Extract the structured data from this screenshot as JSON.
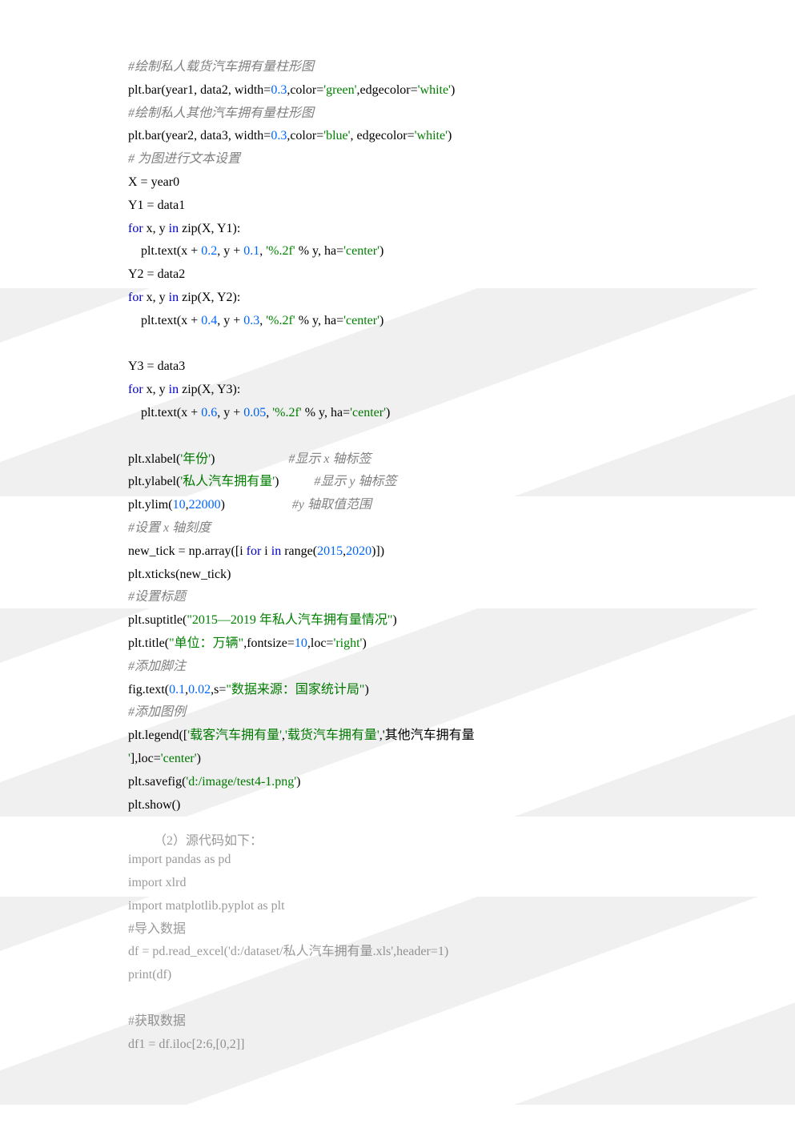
{
  "block1": {
    "lines": [
      {
        "segs": [
          {
            "t": "#绘制私人载货汽车拥有量柱形图",
            "cls": "c-cmt"
          }
        ]
      },
      {
        "segs": [
          {
            "t": "plt.bar(year1, data2, "
          },
          {
            "t": "width",
            "cls": "c-id"
          },
          {
            "t": "="
          },
          {
            "t": "0.3",
            "cls": "c-num"
          },
          {
            "t": ","
          },
          {
            "t": "color",
            "cls": "c-id"
          },
          {
            "t": "="
          },
          {
            "t": "'green'",
            "cls": "c-str"
          },
          {
            "t": ","
          },
          {
            "t": "edgecolor",
            "cls": "c-id"
          },
          {
            "t": "="
          },
          {
            "t": "'white'",
            "cls": "c-str"
          },
          {
            "t": ")"
          }
        ]
      },
      {
        "segs": [
          {
            "t": "#绘制私人其他汽车拥有量柱形图",
            "cls": "c-cmt"
          }
        ]
      },
      {
        "segs": [
          {
            "t": "plt.bar(year2, data3, "
          },
          {
            "t": "width",
            "cls": "c-id"
          },
          {
            "t": "="
          },
          {
            "t": "0.3",
            "cls": "c-num"
          },
          {
            "t": ","
          },
          {
            "t": "color",
            "cls": "c-id"
          },
          {
            "t": "="
          },
          {
            "t": "'blue'",
            "cls": "c-str"
          },
          {
            "t": ", "
          },
          {
            "t": "edgecolor",
            "cls": "c-id"
          },
          {
            "t": "="
          },
          {
            "t": "'white'",
            "cls": "c-str"
          },
          {
            "t": ")"
          }
        ]
      },
      {
        "segs": [
          {
            "t": "# 为图进行文本设置",
            "cls": "c-cmt"
          }
        ]
      },
      {
        "segs": [
          {
            "t": "X = year0"
          }
        ]
      },
      {
        "segs": [
          {
            "t": "Y1 = data1"
          }
        ]
      },
      {
        "segs": [
          {
            "t": "for ",
            "cls": "c-kw"
          },
          {
            "t": "x, y "
          },
          {
            "t": "in ",
            "cls": "c-kw"
          },
          {
            "t": "zip(X, Y1):"
          }
        ]
      },
      {
        "segs": [
          {
            "t": "    plt.text(x + "
          },
          {
            "t": "0.2",
            "cls": "c-num"
          },
          {
            "t": ", y + "
          },
          {
            "t": "0.1",
            "cls": "c-num"
          },
          {
            "t": ", "
          },
          {
            "t": "'%.2f'",
            "cls": "c-str"
          },
          {
            "t": " % y, "
          },
          {
            "t": "ha",
            "cls": "c-id"
          },
          {
            "t": "="
          },
          {
            "t": "'center'",
            "cls": "c-str"
          },
          {
            "t": ")"
          }
        ]
      },
      {
        "segs": [
          {
            "t": "Y2 = data2"
          }
        ]
      },
      {
        "segs": [
          {
            "t": "for ",
            "cls": "c-kw"
          },
          {
            "t": "x, y "
          },
          {
            "t": "in ",
            "cls": "c-kw"
          },
          {
            "t": "zip(X, Y2):"
          }
        ]
      },
      {
        "segs": [
          {
            "t": "    plt.text(x + "
          },
          {
            "t": "0.4",
            "cls": "c-num"
          },
          {
            "t": ", y + "
          },
          {
            "t": "0.3",
            "cls": "c-num"
          },
          {
            "t": ", "
          },
          {
            "t": "'%.2f'",
            "cls": "c-str"
          },
          {
            "t": " % y, "
          },
          {
            "t": "ha",
            "cls": "c-id"
          },
          {
            "t": "="
          },
          {
            "t": "'center'",
            "cls": "c-str"
          },
          {
            "t": ")"
          }
        ]
      },
      {
        "segs": [
          {
            "t": ""
          }
        ]
      },
      {
        "segs": [
          {
            "t": "Y3 = data3"
          }
        ]
      },
      {
        "segs": [
          {
            "t": "for ",
            "cls": "c-kw"
          },
          {
            "t": "x, y "
          },
          {
            "t": "in ",
            "cls": "c-kw"
          },
          {
            "t": "zip(X, Y3):"
          }
        ]
      },
      {
        "segs": [
          {
            "t": "    plt.text(x + "
          },
          {
            "t": "0.6",
            "cls": "c-num"
          },
          {
            "t": ", y + "
          },
          {
            "t": "0.05",
            "cls": "c-num"
          },
          {
            "t": ", "
          },
          {
            "t": "'%.2f'",
            "cls": "c-str"
          },
          {
            "t": " % y, "
          },
          {
            "t": "ha",
            "cls": "c-id"
          },
          {
            "t": "="
          },
          {
            "t": "'center'",
            "cls": "c-str"
          },
          {
            "t": ")"
          }
        ]
      },
      {
        "segs": [
          {
            "t": ""
          }
        ]
      },
      {
        "segs": [
          {
            "t": "plt.xlabel("
          },
          {
            "t": "'年份'",
            "cls": "c-str"
          },
          {
            "t": ")                       "
          },
          {
            "t": "#显示 x 轴标签",
            "cls": "c-cmt"
          }
        ]
      },
      {
        "segs": [
          {
            "t": "plt.ylabel("
          },
          {
            "t": "'私人汽车拥有量'",
            "cls": "c-str"
          },
          {
            "t": ")           "
          },
          {
            "t": "#显示 y 轴标签",
            "cls": "c-cmt"
          }
        ]
      },
      {
        "segs": [
          {
            "t": "plt.ylim("
          },
          {
            "t": "10",
            "cls": "c-num"
          },
          {
            "t": ","
          },
          {
            "t": "22000",
            "cls": "c-num"
          },
          {
            "t": ")                     "
          },
          {
            "t": "#y 轴取值范围",
            "cls": "c-cmt"
          }
        ]
      },
      {
        "segs": [
          {
            "t": "#设置 x 轴刻度",
            "cls": "c-cmt"
          }
        ]
      },
      {
        "segs": [
          {
            "t": "new_tick = np.array([i "
          },
          {
            "t": "for ",
            "cls": "c-kw"
          },
          {
            "t": "i "
          },
          {
            "t": "in ",
            "cls": "c-kw"
          },
          {
            "t": "range("
          },
          {
            "t": "2015",
            "cls": "c-num"
          },
          {
            "t": ","
          },
          {
            "t": "2020",
            "cls": "c-num"
          },
          {
            "t": ")])"
          }
        ]
      },
      {
        "segs": [
          {
            "t": "plt.xticks(new_tick)"
          }
        ]
      },
      {
        "segs": [
          {
            "t": "#设置标题",
            "cls": "c-cmt"
          }
        ]
      },
      {
        "segs": [
          {
            "t": "plt.suptitle("
          },
          {
            "t": "\"2015—2019 年私人汽车拥有量情况\"",
            "cls": "c-str"
          },
          {
            "t": ")"
          }
        ]
      },
      {
        "segs": [
          {
            "t": "plt.title("
          },
          {
            "t": "\"单位：万辆\"",
            "cls": "c-str"
          },
          {
            "t": ","
          },
          {
            "t": "fontsize",
            "cls": "c-id"
          },
          {
            "t": "="
          },
          {
            "t": "10",
            "cls": "c-num"
          },
          {
            "t": ","
          },
          {
            "t": "loc",
            "cls": "c-id"
          },
          {
            "t": "="
          },
          {
            "t": "'right'",
            "cls": "c-str"
          },
          {
            "t": ")"
          }
        ]
      },
      {
        "segs": [
          {
            "t": "#添加脚注",
            "cls": "c-cmt"
          }
        ]
      },
      {
        "segs": [
          {
            "t": "fig.text("
          },
          {
            "t": "0.1",
            "cls": "c-num"
          },
          {
            "t": ","
          },
          {
            "t": "0.02",
            "cls": "c-num"
          },
          {
            "t": ","
          },
          {
            "t": "s",
            "cls": "c-id"
          },
          {
            "t": "="
          },
          {
            "t": "\"数据来源：国家统计局\"",
            "cls": "c-str"
          },
          {
            "t": ")"
          }
        ]
      },
      {
        "segs": [
          {
            "t": "#添加图例",
            "cls": "c-cmt"
          }
        ]
      },
      {
        "segs": [
          {
            "t": "plt.legend(["
          },
          {
            "t": "'载客汽车拥有量'",
            "cls": "c-str"
          },
          {
            "t": ","
          },
          {
            "t": "'载货汽车拥有量'",
            "cls": "c-str"
          },
          {
            "t": ","
          },
          {
            "t": "'其他汽车拥有量"
          }
        ]
      },
      {
        "segs": [
          {
            "t": "'",
            "cls": "c-str"
          },
          {
            "t": "],"
          },
          {
            "t": "loc",
            "cls": "c-id"
          },
          {
            "t": "="
          },
          {
            "t": "'center'",
            "cls": "c-str"
          },
          {
            "t": ")"
          }
        ]
      },
      {
        "segs": [
          {
            "t": "plt.savefig("
          },
          {
            "t": "'d:/image/test4-1.png'",
            "cls": "c-str"
          },
          {
            "t": ")"
          }
        ]
      },
      {
        "segs": [
          {
            "t": "plt.show()"
          }
        ]
      }
    ]
  },
  "heading2": "（2）源代码如下：",
  "block2": {
    "lines": [
      {
        "segs": [
          {
            "t": "import pandas as pd"
          }
        ]
      },
      {
        "segs": [
          {
            "t": "import xlrd"
          }
        ]
      },
      {
        "segs": [
          {
            "t": "import matplotlib.pyplot as plt"
          }
        ]
      },
      {
        "segs": [
          {
            "t": "#导入数据"
          }
        ]
      },
      {
        "segs": [
          {
            "t": "df = pd.read_excel('d:/dataset/私人汽车拥有量.xls',header=1)"
          }
        ]
      },
      {
        "segs": [
          {
            "t": "print(df)"
          }
        ]
      },
      {
        "segs": [
          {
            "t": ""
          }
        ]
      },
      {
        "segs": [
          {
            "t": "#获取数据"
          }
        ]
      },
      {
        "segs": [
          {
            "t": "df1 = df.iloc[2:6,[0,2]]"
          }
        ]
      }
    ]
  }
}
